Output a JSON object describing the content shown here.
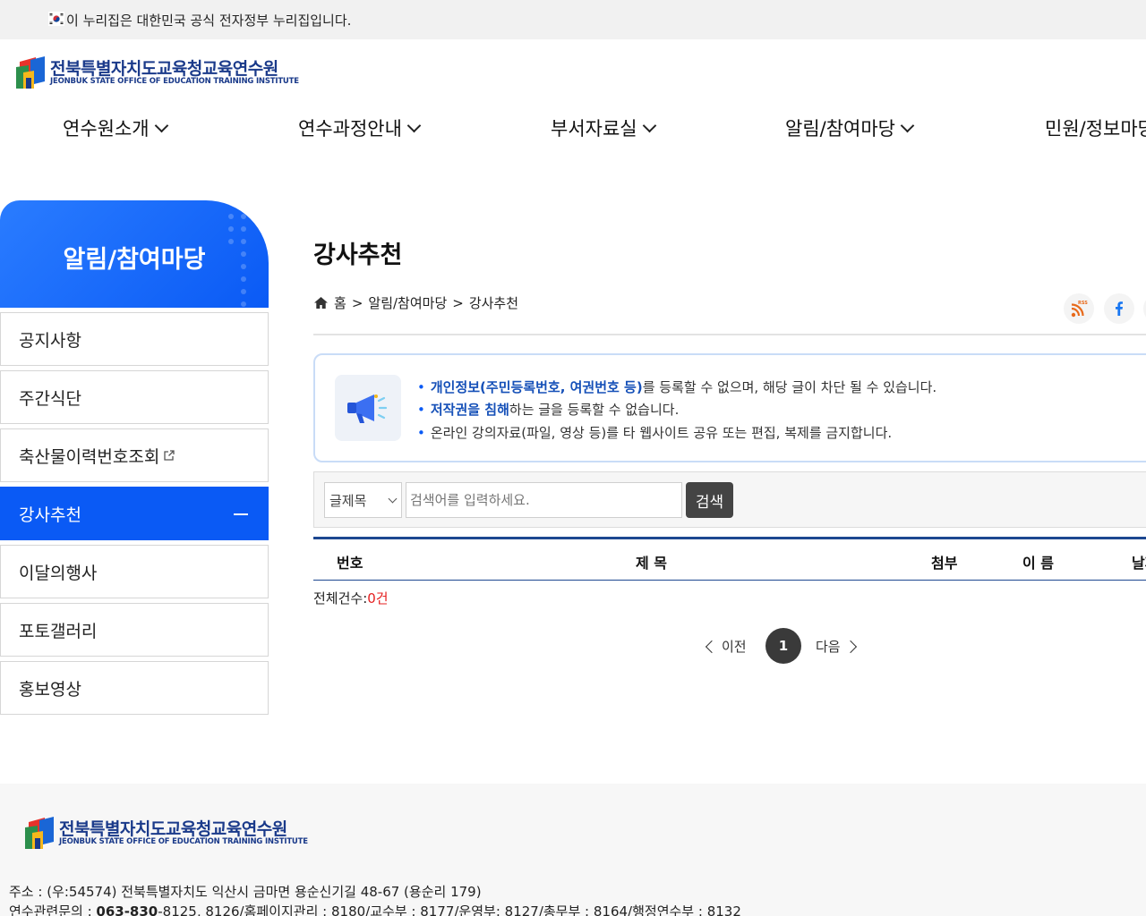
{
  "gov_banner": {
    "text": "이 누리집은 대한민국 공식 전자정부 누리집입니다."
  },
  "logo": {
    "name_ko": "전북특별자치도교육청교육연수원",
    "name_en": "JEONBUK STATE OFFICE OF EDUCATION TRAINING INSTITUTE"
  },
  "gnb": [
    {
      "label": "연수원소개"
    },
    {
      "label": "연수과정안내"
    },
    {
      "label": "부서자료실"
    },
    {
      "label": "알림/참여마당"
    },
    {
      "label": "민원/정보마당"
    }
  ],
  "sidebar": {
    "title": "알림/참여마당",
    "items": [
      {
        "label": "공지사항"
      },
      {
        "label": "주간식단"
      },
      {
        "label": "축산물이력번호조회"
      },
      {
        "label": "강사추천"
      },
      {
        "label": "이달의행사"
      },
      {
        "label": "포토갤러리"
      },
      {
        "label": "홍보영상"
      }
    ]
  },
  "page": {
    "title": "강사추천",
    "breadcrumb": {
      "home": "홈",
      "sep": ">",
      "section": "알림/참여마당",
      "current": "강사추천"
    }
  },
  "notice": {
    "line1_em": "개인정보(주민등록번호, 여권번호 등)",
    "line1_rest": "를 등록할 수 없으며, 해당 글이 차단 될 수 있습니다.",
    "line2_em": "저작권을 침해",
    "line2_rest": "하는 글을 등록할 수 없습니다.",
    "line3": "온라인 강의자료(파일, 영상 등)를 타 웹사이트 공유 또는 편집, 복제를 금지합니다."
  },
  "search": {
    "select_value": "글제목",
    "placeholder": "검색어를 입력하세요.",
    "button": "검색"
  },
  "table": {
    "headers": [
      "번호",
      "제 목",
      "첨부",
      "이 름",
      "날짜"
    ]
  },
  "total": {
    "label": "전체건수:",
    "count": "0건"
  },
  "pagination": {
    "prev": "이전",
    "current": "1",
    "next": "다음"
  },
  "footer": {
    "address": "주소 : (우:54574) 전북특별자치도 익산시 금마면 용순신기길 48-67 (용순리 179)",
    "tel_label": "연수관련문의 : ",
    "tel_main": "063-830",
    "tel_rest": "-8125, 8126/홈페이지관리 : 8180/교수부 : 8177/운영부: 8127/총무부 : 8164/행정연수부 : 8132"
  },
  "colors": {
    "primary": "#0a5af5",
    "navy": "#1d4790",
    "alert": "#e52020"
  }
}
